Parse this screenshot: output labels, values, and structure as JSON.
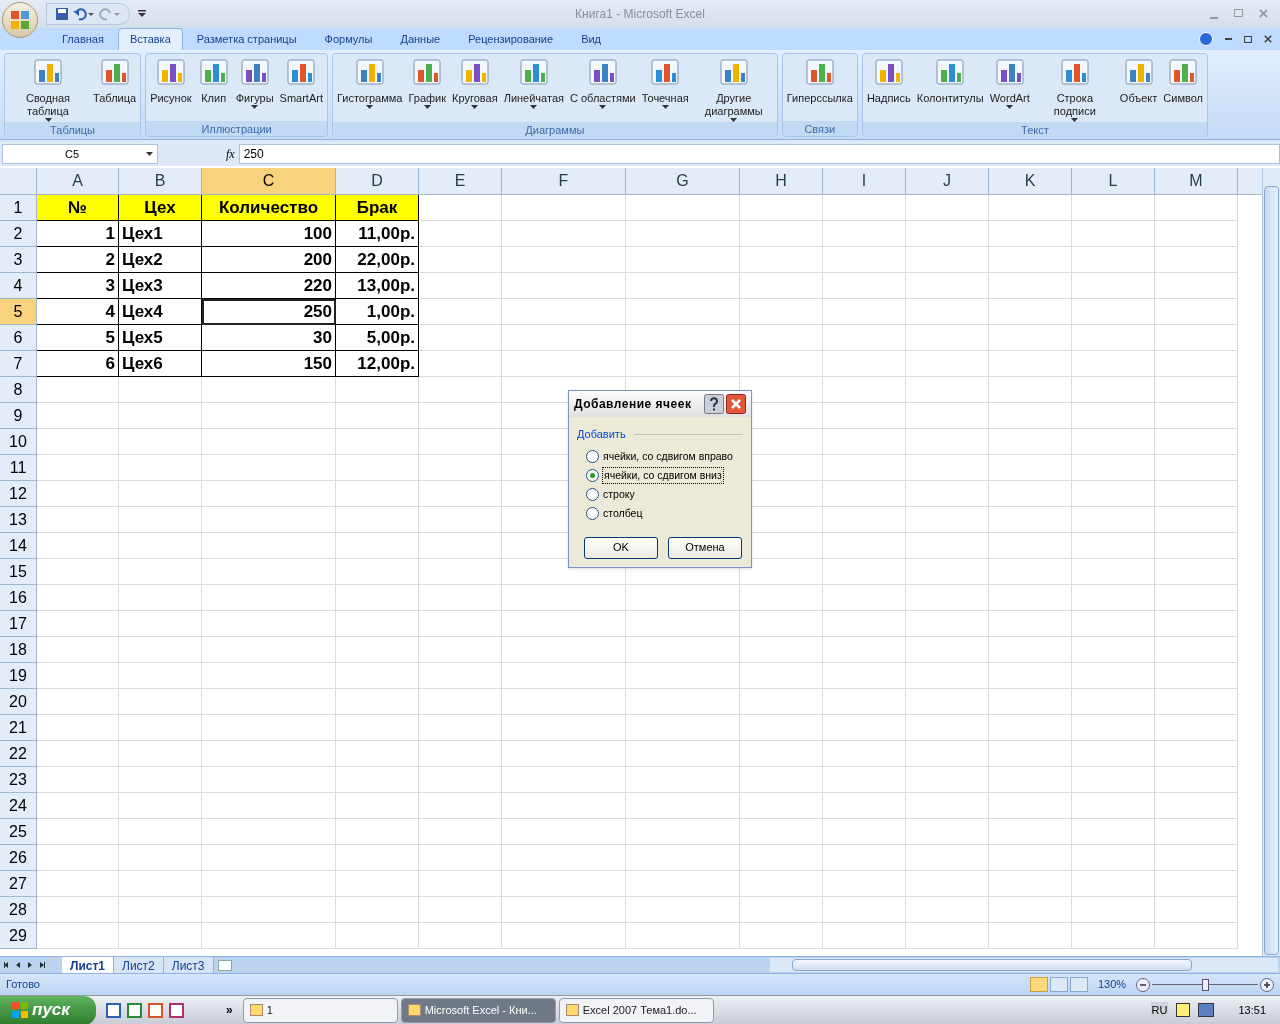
{
  "window": {
    "title": "Книга1 - Microsoft Excel"
  },
  "tabs": [
    {
      "label": "Главная",
      "selected": false
    },
    {
      "label": "Вставка",
      "selected": true
    },
    {
      "label": "Разметка страницы",
      "selected": false
    },
    {
      "label": "Формулы",
      "selected": false
    },
    {
      "label": "Данные",
      "selected": false
    },
    {
      "label": "Рецензирование",
      "selected": false
    },
    {
      "label": "Вид",
      "selected": false
    }
  ],
  "ribbon_groups": [
    {
      "label": "Таблицы",
      "buttons": [
        {
          "label": "Сводная таблица",
          "dropdown": true
        },
        {
          "label": "Таблица",
          "dropdown": false
        }
      ]
    },
    {
      "label": "Иллюстрации",
      "buttons": [
        {
          "label": "Рисунок",
          "dropdown": false
        },
        {
          "label": "Клип",
          "dropdown": false
        },
        {
          "label": "Фигуры",
          "dropdown": true
        },
        {
          "label": "SmartArt",
          "dropdown": false
        }
      ]
    },
    {
      "label": "Диаграммы",
      "buttons": [
        {
          "label": "Гистограмма",
          "dropdown": true
        },
        {
          "label": "График",
          "dropdown": true
        },
        {
          "label": "Круговая",
          "dropdown": true
        },
        {
          "label": "Линейчатая",
          "dropdown": true
        },
        {
          "label": "С областями",
          "dropdown": true
        },
        {
          "label": "Точечная",
          "dropdown": true
        },
        {
          "label": "Другие диаграммы",
          "dropdown": true
        }
      ]
    },
    {
      "label": "Связи",
      "buttons": [
        {
          "label": "Гиперссылка",
          "dropdown": false
        }
      ]
    },
    {
      "label": "Текст",
      "buttons": [
        {
          "label": "Надпись",
          "dropdown": false
        },
        {
          "label": "Колонтитулы",
          "dropdown": false
        },
        {
          "label": "WordArt",
          "dropdown": true
        },
        {
          "label": "Строка подписи",
          "dropdown": true
        },
        {
          "label": "Объект",
          "dropdown": false
        },
        {
          "label": "Символ",
          "dropdown": false
        }
      ]
    }
  ],
  "formula_bar": {
    "name_box": "C5",
    "fx": "fx",
    "formula": "250"
  },
  "columns": [
    {
      "label": "A",
      "selected": false
    },
    {
      "label": "B",
      "selected": false
    },
    {
      "label": "C",
      "selected": true
    },
    {
      "label": "D",
      "selected": false
    },
    {
      "label": "E",
      "selected": false
    },
    {
      "label": "F",
      "selected": false
    },
    {
      "label": "G",
      "selected": false
    },
    {
      "label": "H",
      "selected": false
    },
    {
      "label": "I",
      "selected": false
    },
    {
      "label": "J",
      "selected": false
    },
    {
      "label": "K",
      "selected": false
    },
    {
      "label": "L",
      "selected": false
    },
    {
      "label": "M",
      "selected": false
    }
  ],
  "row_numbers": [
    {
      "label": "1",
      "selected": false
    },
    {
      "label": "2",
      "selected": false
    },
    {
      "label": "3",
      "selected": false
    },
    {
      "label": "4",
      "selected": false
    },
    {
      "label": "5",
      "selected": true
    },
    {
      "label": "6",
      "selected": false
    },
    {
      "label": "7",
      "selected": false
    },
    {
      "label": "8",
      "selected": false
    },
    {
      "label": "9",
      "selected": false
    },
    {
      "label": "10",
      "selected": false
    },
    {
      "label": "11",
      "selected": false
    },
    {
      "label": "12",
      "selected": false
    },
    {
      "label": "13",
      "selected": false
    },
    {
      "label": "14",
      "selected": false
    },
    {
      "label": "15",
      "selected": false
    },
    {
      "label": "16",
      "selected": false
    },
    {
      "label": "17",
      "selected": false
    },
    {
      "label": "18",
      "selected": false
    },
    {
      "label": "19",
      "selected": false
    },
    {
      "label": "20",
      "selected": false
    },
    {
      "label": "21",
      "selected": false
    },
    {
      "label": "22",
      "selected": false
    },
    {
      "label": "23",
      "selected": false
    },
    {
      "label": "24",
      "selected": false
    },
    {
      "label": "25",
      "selected": false
    },
    {
      "label": "26",
      "selected": false
    },
    {
      "label": "27",
      "selected": false
    },
    {
      "label": "28",
      "selected": false
    },
    {
      "label": "29",
      "selected": false
    }
  ],
  "table": {
    "rows": [
      {
        "kind": "header",
        "cells": [
          {
            "text": "№",
            "selected": false
          },
          {
            "text": "Цех",
            "selected": false
          },
          {
            "text": "Количество",
            "selected": false
          },
          {
            "text": "Брак",
            "selected": false
          }
        ]
      },
      {
        "kind": "data",
        "cells": [
          {
            "text": "1",
            "selected": false
          },
          {
            "text": "Цех1",
            "selected": false
          },
          {
            "text": "100",
            "selected": false
          },
          {
            "text": "11,00р.",
            "selected": false
          }
        ]
      },
      {
        "kind": "data",
        "cells": [
          {
            "text": "2",
            "selected": false
          },
          {
            "text": "Цех2",
            "selected": false
          },
          {
            "text": "200",
            "selected": false
          },
          {
            "text": "22,00р.",
            "selected": false
          }
        ]
      },
      {
        "kind": "data",
        "cells": [
          {
            "text": "3",
            "selected": false
          },
          {
            "text": "Цех3",
            "selected": false
          },
          {
            "text": "220",
            "selected": false
          },
          {
            "text": "13,00р.",
            "selected": false
          }
        ]
      },
      {
        "kind": "data",
        "cells": [
          {
            "text": "4",
            "selected": false
          },
          {
            "text": "Цех4",
            "selected": false
          },
          {
            "text": "250",
            "selected": true
          },
          {
            "text": "1,00р.",
            "selected": false
          }
        ]
      },
      {
        "kind": "data",
        "cells": [
          {
            "text": "5",
            "selected": false
          },
          {
            "text": "Цех5",
            "selected": false
          },
          {
            "text": "30",
            "selected": false
          },
          {
            "text": "5,00р.",
            "selected": false
          }
        ]
      },
      {
        "kind": "data",
        "cells": [
          {
            "text": "6",
            "selected": false
          },
          {
            "text": "Цех6",
            "selected": false
          },
          {
            "text": "150",
            "selected": false
          },
          {
            "text": "12,00р.",
            "selected": false
          }
        ]
      }
    ]
  },
  "dialog": {
    "title": "Добавление ячеек",
    "group": "Добавить",
    "options": [
      {
        "label": "ячейки, со сдвигом вправо",
        "selected": false
      },
      {
        "label": "ячейки, со сдвигом вниз",
        "selected": true
      },
      {
        "label": "строку",
        "selected": false
      },
      {
        "label": "столбец",
        "selected": false
      }
    ],
    "buttons": [
      "OK",
      "Отмена"
    ]
  },
  "sheet_tabs": [
    {
      "label": "Лист1",
      "selected": true
    },
    {
      "label": "Лист2",
      "selected": false
    },
    {
      "label": "Лист3",
      "selected": false
    }
  ],
  "status_bar": {
    "status": "Готово",
    "zoom": "130%",
    "zoom_slider": {
      "level": 0.5
    }
  },
  "taskbar": {
    "start": "пуск",
    "more": "»",
    "windows": [
      {
        "label": "1",
        "selected": false
      },
      {
        "label": "Microsoft Excel - Кни...",
        "selected": true
      },
      {
        "label": "Excel 2007 Тема1.do...",
        "selected": false
      }
    ],
    "language": "RU",
    "clock": "13:51"
  }
}
